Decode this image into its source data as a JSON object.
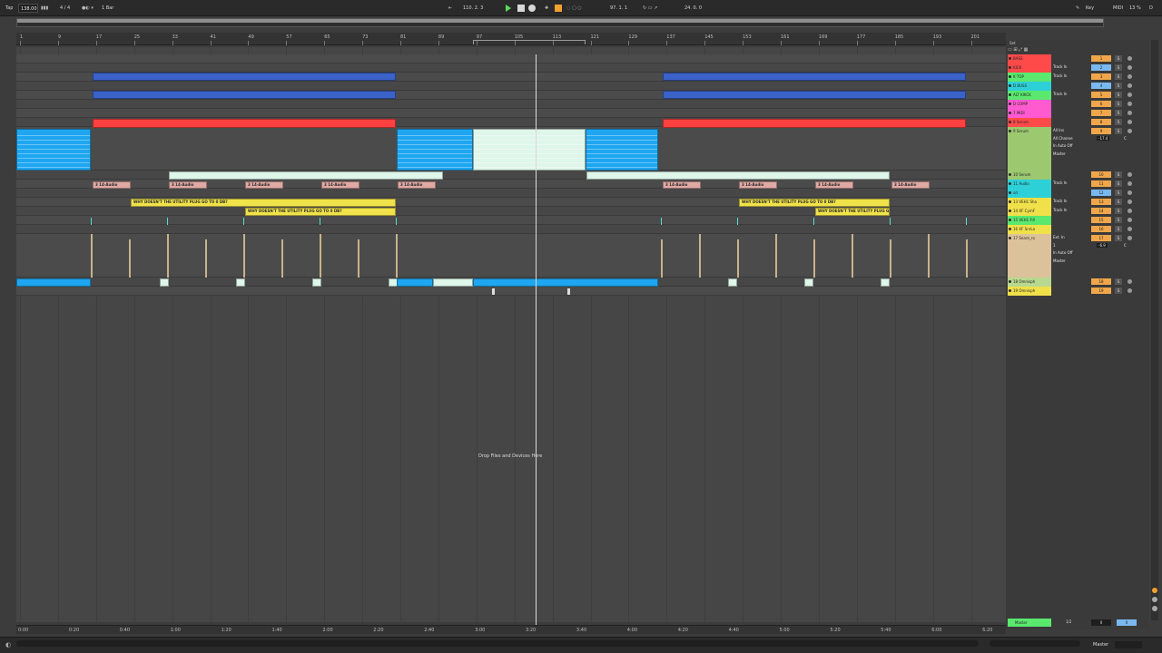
{
  "topbar": {
    "tap": "Tap",
    "tempo": "138.00",
    "meter": "4 / 4",
    "quantize": "1 Bar",
    "arrangement_position": "110.  2.  3",
    "loop_start": "97.  1.  1",
    "loop_length": "24.  0.  0",
    "key_label": "Key",
    "midi_label": "MIDI",
    "cpu_load": "13 %",
    "disk_label": "D"
  },
  "ruler": {
    "bars": [
      "1",
      "9",
      "17",
      "25",
      "33",
      "41",
      "49",
      "57",
      "65",
      "73",
      "81",
      "89",
      "97",
      "105",
      "113",
      "121",
      "129",
      "137",
      "145",
      "153",
      "161",
      "169",
      "177",
      "185",
      "193",
      "201"
    ],
    "set_label": "Set"
  },
  "timeline": {
    "times": [
      "0:00",
      "0:20",
      "0:40",
      "1:00",
      "1:20",
      "1:40",
      "2:00",
      "2:20",
      "2:40",
      "3:00",
      "3:20",
      "3:40",
      "4:00",
      "4:20",
      "4:40",
      "5:00",
      "5:20",
      "5:40",
      "6:00",
      "6:20"
    ]
  },
  "drop_message": "Drop Files and Devices Here",
  "tracks": [
    {
      "name": "BASS",
      "color": "#ff4a4a",
      "num": "1",
      "io": ""
    },
    {
      "name": "KICK",
      "color": "#ff4a4a",
      "num": "2",
      "io": "Track In"
    },
    {
      "name": "K TOP",
      "color": "#5ae86e",
      "num": "3",
      "io": "Track In"
    },
    {
      "name": "D BUSS",
      "color": "#2ed0d8",
      "num": "4",
      "io": ""
    },
    {
      "name": "ALT KIKCK",
      "color": "#5ae86e",
      "num": "5",
      "io": "Track In"
    },
    {
      "name": "D COMP",
      "color": "#ff5ad0",
      "num": "6",
      "io": ""
    },
    {
      "name": "7 MIDI",
      "color": "#ff5ad0",
      "num": "7",
      "io": ""
    },
    {
      "name": "8 Serum",
      "color": "#ff4a4a",
      "num": "8",
      "io": ""
    },
    {
      "name": "9 Serum",
      "color": "#9cc870",
      "num": "9",
      "io": "All Ins",
      "io2": "All Channe",
      "io3": "In  Auto  Off",
      "io4": "Master",
      "vol": "-17.4",
      "pan": "C"
    },
    {
      "name": "10 Serum",
      "color": "#9cc870",
      "num": "10",
      "io": ""
    },
    {
      "name": "11 Audio",
      "color": "#2ed0d8",
      "num": "11",
      "io": "Track In"
    },
    {
      "name": "s/s",
      "color": "#2ed0d8",
      "num": "12",
      "io": ""
    },
    {
      "name": "13 VEH1 Sha",
      "color": "#f0e04a",
      "num": "13",
      "io": "Track In"
    },
    {
      "name": "14 XF CymF",
      "color": "#f0e04a",
      "num": "14",
      "io": "Track In"
    },
    {
      "name": "15 VEH1 Fill",
      "color": "#5ae86e",
      "num": "15",
      "io": ""
    },
    {
      "name": "16 XF SnrLa",
      "color": "#f0e04a",
      "num": "16",
      "io": ""
    },
    {
      "name": "17 Snare_ro",
      "color": "#dcc29a",
      "num": "17",
      "io": "Ext. In",
      "io2": "1",
      "io3": "In  Auto  Off",
      "io4": "Master",
      "vol": "-6.9",
      "pan": "C"
    },
    {
      "name": "18 Omnisph",
      "color": "#b8d890",
      "num": "18",
      "io": ""
    },
    {
      "name": "19 Omnisph",
      "color": "#f0e04a",
      "num": "19",
      "io": ""
    }
  ],
  "clips": {
    "audio_label": "3 14-Audio",
    "utility_label": "WHY DOESN'T THE UTILITY PLUG GO TO 0 DB?"
  },
  "master": {
    "name": "Master",
    "io": "1/2",
    "num": "0"
  },
  "bottombar": {
    "master_label": "Master"
  },
  "colors": {
    "bass_blue": "#3a62c8",
    "kick_red": "#ff4040",
    "serum_cyan": "#1ea6f0",
    "serum_light": "#dff6ea",
    "audio_pink": "#e0a9a4",
    "utility_yellow": "#f0e24a",
    "snare_tan": "#c8b28a"
  }
}
